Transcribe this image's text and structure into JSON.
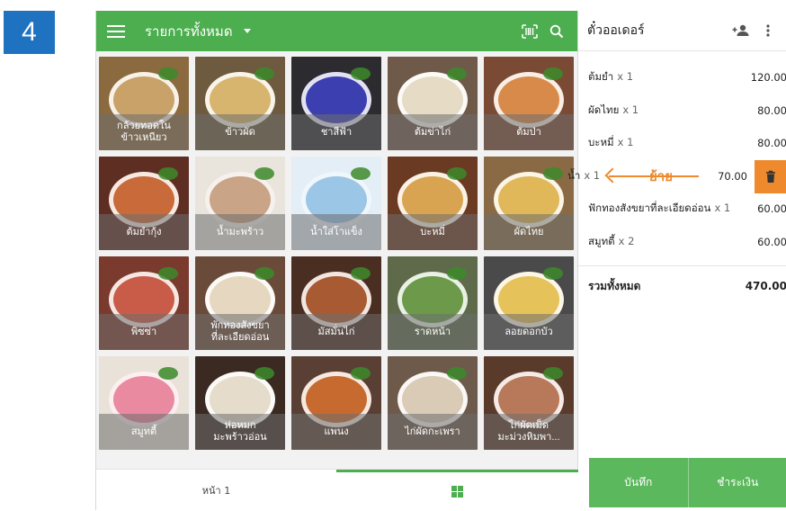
{
  "step": "4",
  "header": {
    "title": "รายการทั้งหมด"
  },
  "colors": {
    "accent": "#4cae4f",
    "delete": "#ee8a2d",
    "step_badge": "#1f72c0"
  },
  "products": [
    {
      "name": "กล้วยทอดใน\nข้าวเหนียว",
      "bg": "#8a6a3e",
      "plate": "#c9a269"
    },
    {
      "name": "ข้าวผัด",
      "bg": "#6e5a3e",
      "plate": "#d8b56f"
    },
    {
      "name": "ชาสีฟ้า",
      "bg": "#2c2b30",
      "plate": "#3c3fb0"
    },
    {
      "name": "ต้มข่าไก่",
      "bg": "#6f5a4a",
      "plate": "#e6dcc6"
    },
    {
      "name": "ต้มป่า",
      "bg": "#7a4a34",
      "plate": "#d88a4a"
    },
    {
      "name": "ต้มยำกุ้ง",
      "bg": "#5e2e22",
      "plate": "#c86a3a"
    },
    {
      "name": "น้ำมะพร้าว",
      "bg": "#e9e4dc",
      "plate": "#c9a486"
    },
    {
      "name": "น้ำใส่โาแข็ง",
      "bg": "#e3eef6",
      "plate": "#9cc6e6"
    },
    {
      "name": "บะหมี่",
      "bg": "#6a3a22",
      "plate": "#d9a452"
    },
    {
      "name": "ผัดไทย",
      "bg": "#8a6a44",
      "plate": "#e0b85a"
    },
    {
      "name": "พิซซ่า",
      "bg": "#7a3a2e",
      "plate": "#c95c48"
    },
    {
      "name": "พักทองสังขยา\nที่ละเอียดอ่อน",
      "bg": "#6a4a38",
      "plate": "#e6d8c0"
    },
    {
      "name": "มัสมั่นไก่",
      "bg": "#4a2e22",
      "plate": "#a85a32"
    },
    {
      "name": "ราดหน้า",
      "bg": "#5e6a4a",
      "plate": "#6c9a4a"
    },
    {
      "name": "ลอยดอกบัว",
      "bg": "#4a4a4a",
      "plate": "#e6c25a"
    },
    {
      "name": "สมูทตี้",
      "bg": "#e8e2d8",
      "plate": "#e98aa0"
    },
    {
      "name": "ห่อหมก\nมะพร้าวอ่อน",
      "bg": "#3a2a22",
      "plate": "#e6dccb"
    },
    {
      "name": "แพนง",
      "bg": "#5a4034",
      "plate": "#c66a30"
    },
    {
      "name": "ไก่ผัดกะเพรา",
      "bg": "#6e5a4a",
      "plate": "#d9cbb5"
    },
    {
      "name": "ไก่ผัดเม็ด\nมะม่วงหิมพา...",
      "bg": "#5a3a2a",
      "plate": "#b8785a"
    }
  ],
  "footer": {
    "page_label": "หน้า 1"
  },
  "order": {
    "title": "ตั๋วออเดอร์",
    "items": [
      {
        "name": "ต้มยำ",
        "qty": "x 1",
        "price": "120.00"
      },
      {
        "name": "ผัดไทย",
        "qty": "x 1",
        "price": "80.00"
      },
      {
        "name": "บะหมี่",
        "qty": "x 1",
        "price": "80.00"
      },
      {
        "name": "น้ำ",
        "qty": "x 1",
        "price": "70.00",
        "swipe_label": "ย้าย"
      },
      {
        "name": "ฟักทองสังขยาที่ละเอียดอ่อน",
        "qty": "x 1",
        "price": "60.00"
      },
      {
        "name": "สมูทตี้",
        "qty": "x 2",
        "price": "60.00"
      }
    ],
    "total_label": "รวมทั้งหมด",
    "total_value": "470.00",
    "save_label": "บันทึก",
    "pay_label": "ชำระเงิน"
  }
}
